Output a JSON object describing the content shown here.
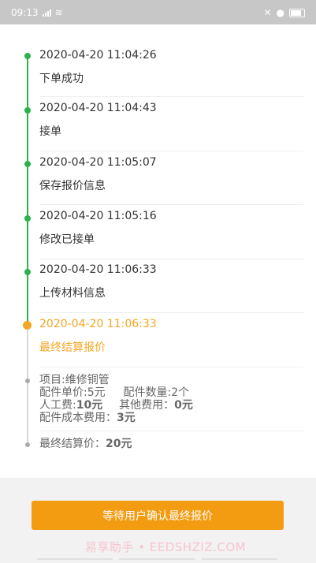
{
  "status": {
    "time": "09:13"
  },
  "timeline": [
    {
      "time": "2020-04-20 11:04:26",
      "label": "下单成功"
    },
    {
      "time": "2020-04-20 11:04:43",
      "label": "接单"
    },
    {
      "time": "2020-04-20 11:05:07",
      "label": "保存报价信息"
    },
    {
      "time": "2020-04-20 11:05:16",
      "label": "修改已接单"
    },
    {
      "time": "2020-04-20 11:06:33",
      "label": "上传材料信息"
    },
    {
      "time": "2020-04-20 11:06:33",
      "label": "最终结算报价"
    }
  ],
  "detail": {
    "project": "项目:维修铜管",
    "unit_price": "配件单价:5元",
    "quantity": "配件数量:2个",
    "labor_label": "人工费:",
    "labor_value": "10元",
    "other_label": "其他费用：",
    "other_value": "0元",
    "parts_cost_label": "配件成本费用：",
    "parts_cost_value": "3元",
    "final_label": "最终结算价：",
    "final_value": "20元"
  },
  "action": {
    "button_label": "等待用户确认最终报价"
  },
  "watermark": "易享助手 • EEDSHZIZ.COM",
  "colors": {
    "accent": "#f39c12",
    "timeline": "#2bb24c",
    "active_text": "#f5a623"
  }
}
